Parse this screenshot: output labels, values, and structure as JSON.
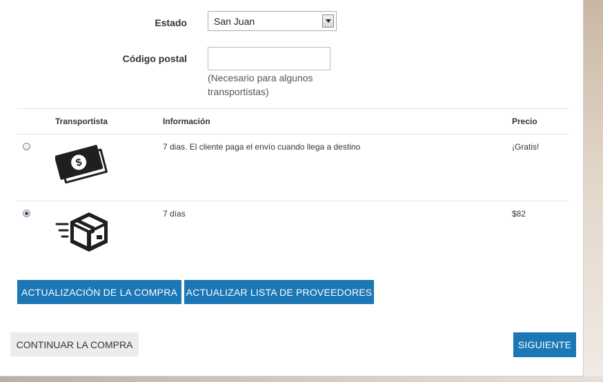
{
  "form": {
    "state_label": "Estado",
    "state_value": "San Juan",
    "zip_label": "Código postal",
    "zip_value": "",
    "zip_hint": "(Necesario para algunos transportistas)"
  },
  "table": {
    "headers": {
      "carrier": "Transportista",
      "info": "Información",
      "price": "Precio"
    },
    "rows": [
      {
        "icon": "cash-bills-icon",
        "info": "7 dias. El cliente paga el envío cuando llega a destino",
        "price": "¡Gratis!",
        "selected": false
      },
      {
        "icon": "fast-delivery-box-icon",
        "info": "7 días",
        "price": "$82",
        "selected": true
      }
    ]
  },
  "buttons": {
    "update_purchase": "ACTUALIZACIÓN DE LA COMPRA",
    "update_providers": "ACTUALIZAR LISTA DE PROVEEDORES",
    "continue": "CONTINUAR LA COMPRA",
    "next": "SIGUIENTE"
  },
  "colors": {
    "primary_button": "#1b77b5",
    "secondary_button": "#ececec"
  }
}
